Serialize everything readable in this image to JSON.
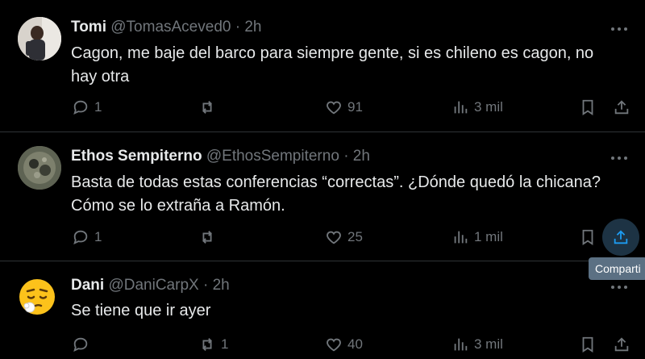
{
  "tweets": [
    {
      "name": "Tomi",
      "handle": "@TomasAceved0",
      "sep": "·",
      "time": "2h",
      "text": "Cagon, me baje del barco para siempre gente, si es chileno es cagon, no hay otra",
      "replies": "1",
      "retweets": "",
      "likes": "91",
      "views": "3 mil"
    },
    {
      "name": "Ethos Sempiterno",
      "handle": "@EthosSempiterno",
      "sep": "·",
      "time": "2h",
      "text": "Basta de todas estas conferencias “correctas”. ¿Dónde quedó la chicana? Cómo se lo extraña a Ramón.",
      "replies": "1",
      "retweets": "",
      "likes": "25",
      "views": "1 mil"
    },
    {
      "name": "Dani",
      "handle": "@DaniCarpX",
      "sep": "·",
      "time": "2h",
      "text": "Se tiene que ir ayer",
      "replies": "",
      "retweets": "1",
      "likes": "40",
      "views": "3 mil"
    }
  ],
  "tooltip": "Comparti",
  "colors": {
    "background": "#000000",
    "muted": "#71767b",
    "accent": "#1d9bf0",
    "divider": "#2f3336"
  }
}
